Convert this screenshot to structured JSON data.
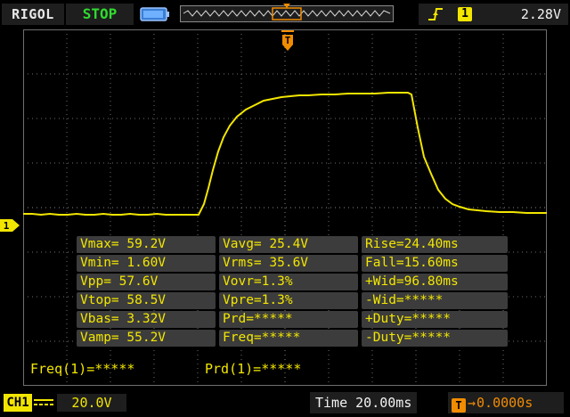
{
  "header": {
    "brand": "RIGOL",
    "run_state": "STOP",
    "trigger": {
      "edge": "rising-edge-icon",
      "source": "1",
      "level": "2.28V"
    }
  },
  "channel_marker": "1",
  "trigger_marker": "T",
  "colors": {
    "trace": "#f2e600",
    "run_state": "#2fdc2f",
    "trigger": "#f28c00",
    "panel": "#3c3c3c",
    "grid": "#6e6e6e"
  },
  "measurements": [
    "Vmax= 59.2V",
    "Vavg= 25.4V",
    "Rise=24.40ms",
    "Vmin= 1.60V",
    "Vrms= 35.6V",
    "Fall=15.60ms",
    "Vpp= 57.6V",
    "Vovr=1.3%",
    "+Wid=96.80ms",
    "Vtop= 58.5V",
    "Vpre=1.3%",
    "-Wid=*****",
    "Vbas= 3.32V",
    "Prd=*****",
    "+Duty=*****",
    "Vamp= 55.2V",
    "Freq=*****",
    "-Duty=*****"
  ],
  "counters": {
    "freq": "Freq(1)=*****",
    "period": "Prd(1)=*****"
  },
  "footer": {
    "channel": "CH1",
    "coupling": "dc-coupling-icon",
    "scale": "20.0V",
    "timebase": "Time 20.00ms",
    "trigger_offset": "0.0000s"
  }
}
